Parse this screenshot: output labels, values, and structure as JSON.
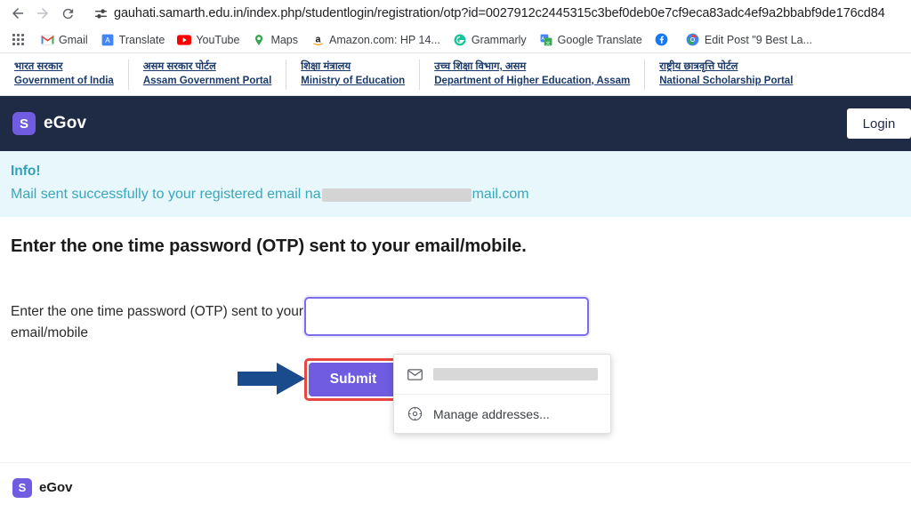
{
  "browser": {
    "url": "gauhati.samarth.edu.in/index.php/studentlogin/registration/otp?id=0027912c2445315c3bef0deb0e7cf9eca83adc4ef9a2bbabf9de176cd84",
    "back_icon": "arrow-left-icon",
    "forward_icon": "arrow-right-icon",
    "reload_icon": "reload-icon",
    "site_settings_icon": "tune-icon",
    "apps_icon": "apps-grid-icon",
    "bookmarks": [
      {
        "label": "Gmail",
        "icon": "gmail-icon"
      },
      {
        "label": "Translate",
        "icon": "translate-icon"
      },
      {
        "label": "YouTube",
        "icon": "youtube-icon"
      },
      {
        "label": "Maps",
        "icon": "maps-icon"
      },
      {
        "label": "Amazon.com: HP 14...",
        "icon": "amazon-icon"
      },
      {
        "label": "Grammarly",
        "icon": "grammarly-icon"
      },
      {
        "label": "Google Translate",
        "icon": "google-translate-icon"
      },
      {
        "label": "",
        "icon": "facebook-icon"
      },
      {
        "label": "Edit Post \"9 Best La...",
        "icon": "chrome-icon"
      }
    ]
  },
  "gov_strip": [
    {
      "hindi": "भारत सरकार",
      "english": "Government of India"
    },
    {
      "hindi": "असम सरकार पोर्टल",
      "english": "Assam Government Portal"
    },
    {
      "hindi": "शिक्षा मंत्रालय",
      "english": "Ministry of Education"
    },
    {
      "hindi": "उच्च शिक्षा विभाग, असम",
      "english": "Department of Higher Education, Assam"
    },
    {
      "hindi": "राष्ट्रीय छात्रवृत्ति पोर्टल",
      "english": "National Scholarship Portal"
    }
  ],
  "site_header": {
    "logo_letter": "S",
    "brand": "eGov",
    "login_label": "Login"
  },
  "info_banner": {
    "title": "Info!",
    "message_before": "Mail sent successfully to your registered email na",
    "message_after": "mail.com"
  },
  "main": {
    "heading": "Enter the one time password (OTP) sent to your email/mobile.",
    "field_label": "Enter the one time password (OTP) sent to your email/mobile",
    "otp_value": "",
    "otp_placeholder": "",
    "submit_label": "Submit",
    "annotation_arrow": "arrow-right-pointer"
  },
  "autofill": {
    "items": [
      {
        "icon": "email-icon",
        "text": ""
      },
      {
        "icon": "settings-gear-icon",
        "text": "Manage addresses..."
      }
    ]
  },
  "footer": {
    "logo_letter": "S",
    "brand": "eGov"
  },
  "colors": {
    "accent_purple": "#6f5ce0",
    "header_navy": "#1f2a44",
    "info_bg": "#e8f7fb",
    "info_text": "#3aa7bd",
    "annotation_red": "#e8473f",
    "annotation_blue": "#1a4b8c"
  }
}
